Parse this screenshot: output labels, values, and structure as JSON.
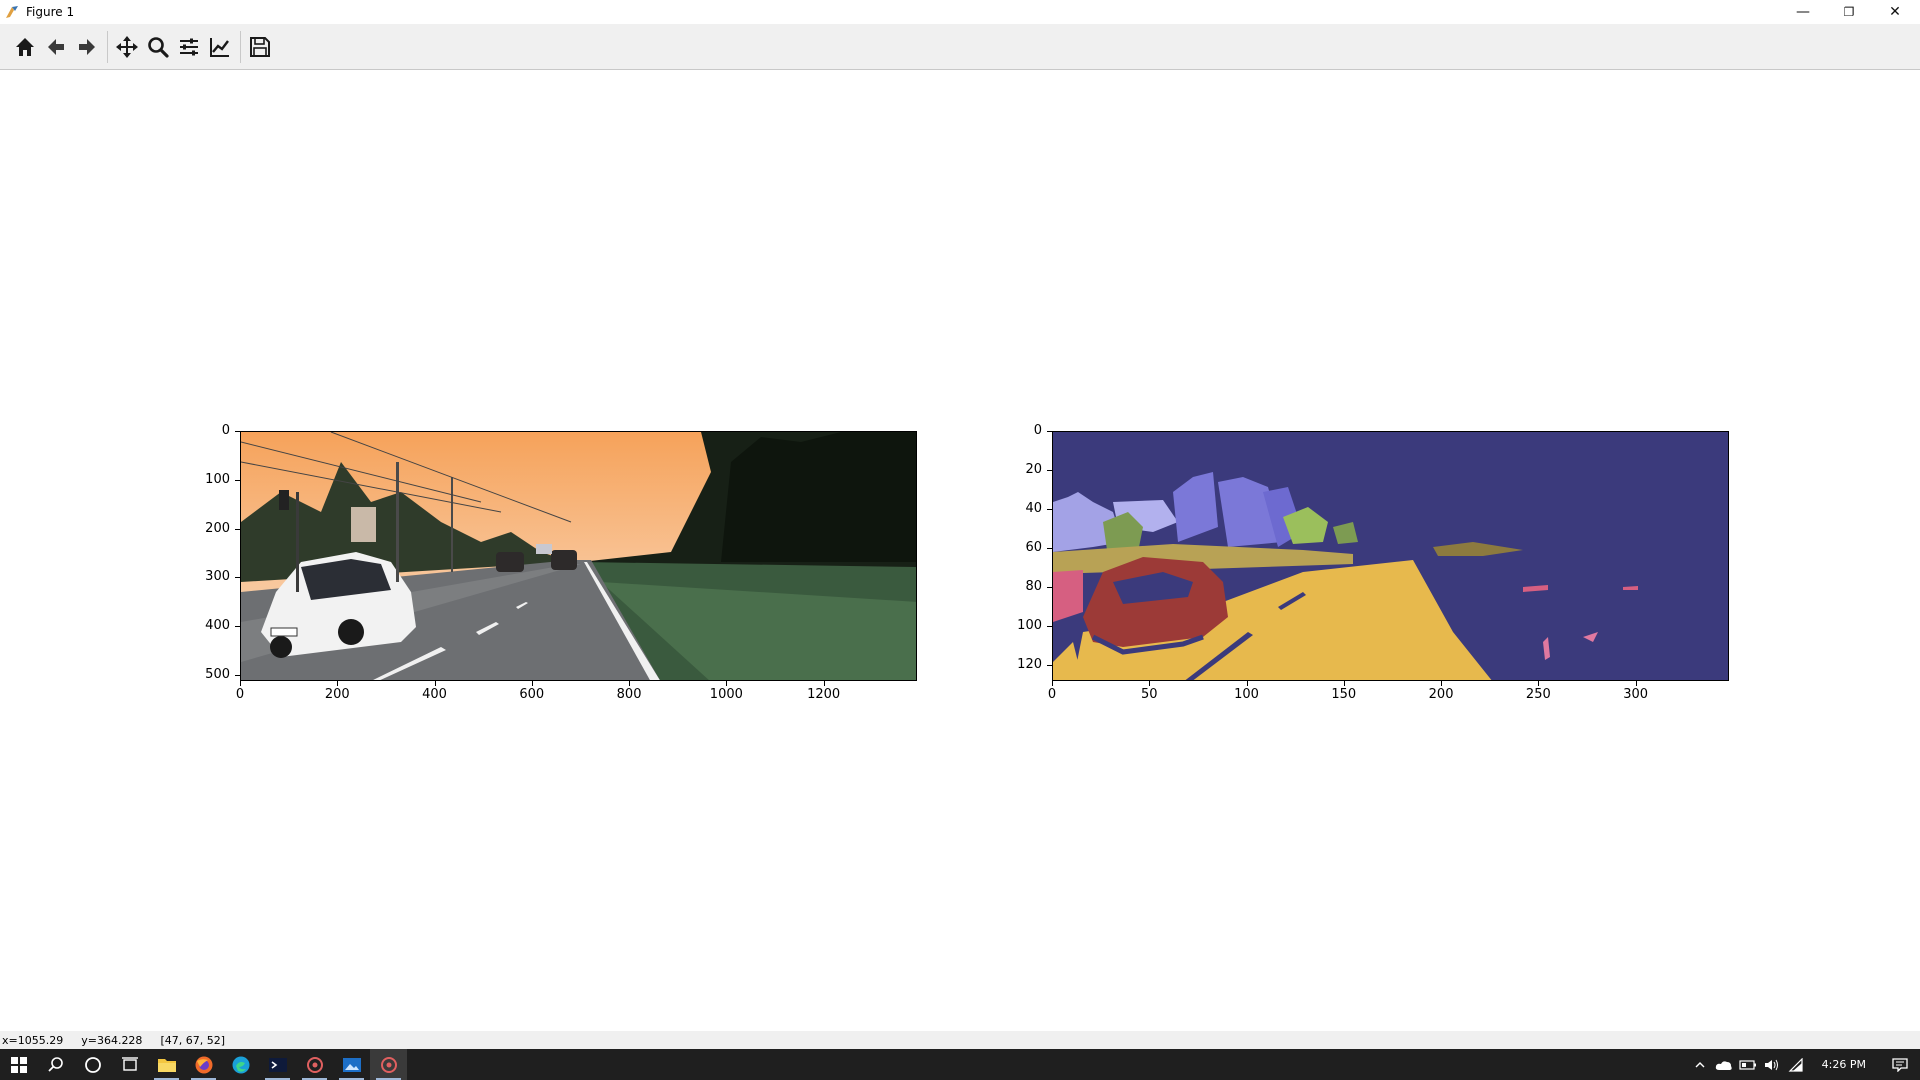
{
  "window": {
    "title": "Figure 1",
    "controls": {
      "minimize": "—",
      "restore": "❐",
      "close": "✕"
    }
  },
  "toolbar": {
    "buttons": [
      {
        "name": "home",
        "icon": "home-icon"
      },
      {
        "name": "back",
        "icon": "arrow-left-icon"
      },
      {
        "name": "forward",
        "icon": "arrow-right-icon"
      },
      {
        "name": "pan",
        "icon": "move-icon"
      },
      {
        "name": "zoom",
        "icon": "magnifier-icon"
      },
      {
        "name": "configure-subplots",
        "icon": "sliders-icon"
      },
      {
        "name": "edit-axes",
        "icon": "chart-line-icon"
      },
      {
        "name": "save",
        "icon": "floppy-icon"
      }
    ]
  },
  "chart_data": [
    {
      "type": "image",
      "xticks": [
        "0",
        "200",
        "400",
        "600",
        "800",
        "1000",
        "1200"
      ],
      "yticks": [
        "0",
        "100",
        "200",
        "300",
        "400",
        "500"
      ],
      "xlim": [
        0,
        1392
      ],
      "ylim": [
        512,
        0
      ]
    },
    {
      "type": "image",
      "xticks": [
        "0",
        "50",
        "100",
        "150",
        "200",
        "250",
        "300"
      ],
      "yticks": [
        "0",
        "20",
        "40",
        "60",
        "80",
        "100",
        "120"
      ],
      "xlim": [
        0,
        348
      ],
      "ylim": [
        128,
        0
      ]
    }
  ],
  "statusbar": {
    "x": "x=1055.29",
    "y": "y=364.228",
    "value": "[47, 67, 52]"
  },
  "taskbar": {
    "clock": "4:26 PM",
    "apps": [
      "windows-start-icon",
      "search-icon",
      "cortana-icon",
      "task-view-icon",
      "file-explorer-icon",
      "firefox-icon",
      "edge-icon",
      "terminal-icon",
      "settings-app-icon",
      "photos-app-icon",
      "python-figure-icon"
    ]
  },
  "colors": {
    "seg_background": "#3b3a7c",
    "seg_road": "#e7b94d",
    "seg_car": "#9c3a37",
    "seg_vegetation": "#7d9b52",
    "seg_building": "#7b78d8",
    "seg_sidewalk": "#e079a0"
  }
}
